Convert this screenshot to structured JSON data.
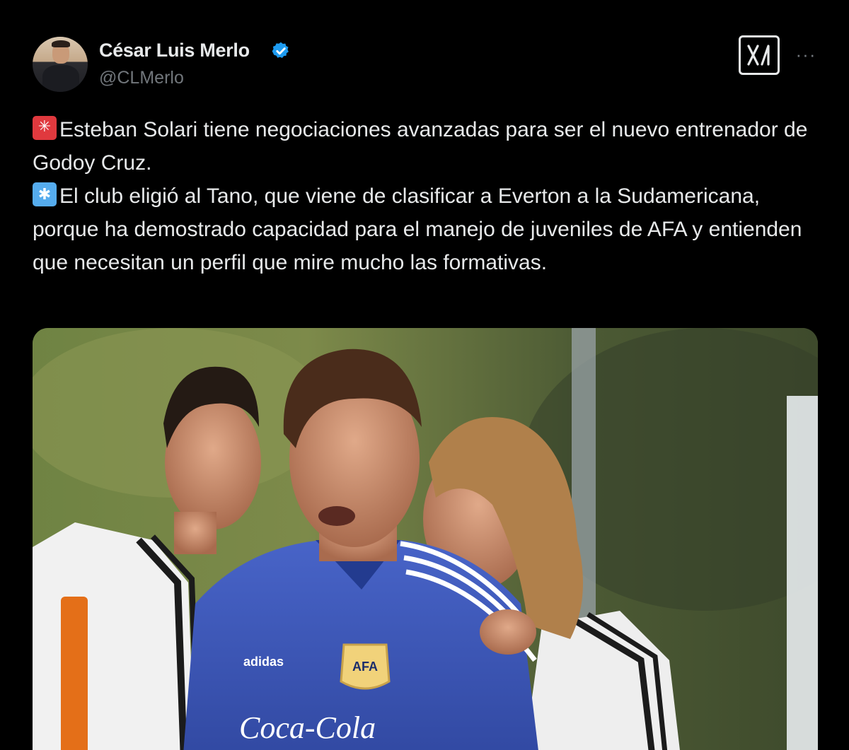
{
  "author": {
    "name": "César Luis Merlo",
    "handle": "@CLMerlo",
    "verified": true,
    "avatar_icon": "profile-photo"
  },
  "header": {
    "logo_icon": "x-logo-icon",
    "more_label": "···"
  },
  "tweet": {
    "paragraphs": [
      {
        "emoji": "rotating-light-emoji",
        "text": "Esteban Solari tiene negociaciones avanzadas para ser el nuevo entrenador de Godoy Cruz."
      },
      {
        "emoji": "eight-spoked-asterisk-emoji",
        "text": "El club eligió al Tano, que viene de clasificar a Everton a la Sudamericana, porque ha demostrado capacidad para el manejo de juveniles de AFA y entienden que necesitan un perfil que mire mucho las formativas."
      }
    ]
  },
  "media": {
    "shirt_brand": "adidas",
    "shirt_sponsor": "Coca-Cola",
    "crest_text": "AFA"
  },
  "colors": {
    "background": "#000000",
    "text": "#e7e9ea",
    "secondary_text": "#71767b",
    "verified_blue": "#1d9bf0",
    "jersey_blue": "#3c56b8"
  }
}
